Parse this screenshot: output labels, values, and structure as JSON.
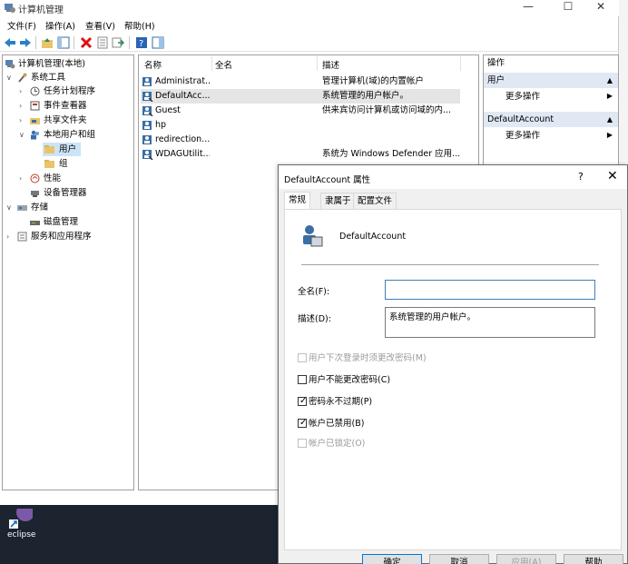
{
  "window": {
    "title": "计算机管理",
    "menus": [
      "文件(F)",
      "操作(A)",
      "查看(V)",
      "帮助(H)"
    ],
    "minimize": "—",
    "maximize": "☐",
    "close": "✕"
  },
  "tree": {
    "root": "计算机管理(本地)",
    "system_tools": "系统工具",
    "task_scheduler": "任务计划程序",
    "event_viewer": "事件查看器",
    "shared_folders": "共享文件夹",
    "local_users_groups": "本地用户和组",
    "users": "用户",
    "groups": "组",
    "performance": "性能",
    "device_manager": "设备管理器",
    "storage": "存储",
    "disk_management": "磁盘管理",
    "services_apps": "服务和应用程序"
  },
  "list": {
    "headers": {
      "name": "名称",
      "fullname": "全名",
      "description": "描述"
    },
    "rows": [
      {
        "name": "Administrat...",
        "fullname": "",
        "description": "管理计算机(域)的内置帐户"
      },
      {
        "name": "DefaultAcc...",
        "fullname": "",
        "description": "系统管理的用户帐户。"
      },
      {
        "name": "Guest",
        "fullname": "",
        "description": "供来宾访问计算机或访问域的内..."
      },
      {
        "name": "hp",
        "fullname": "",
        "description": ""
      },
      {
        "name": "redirection...",
        "fullname": "",
        "description": ""
      },
      {
        "name": "WDAGUtilit...",
        "fullname": "",
        "description": "系统为 Windows Defender 应用..."
      }
    ]
  },
  "actions": {
    "header": "操作",
    "section1": "用户",
    "more1": "更多操作",
    "section2": "DefaultAccount",
    "more2": "更多操作"
  },
  "dialog": {
    "title": "DefaultAccount 属性",
    "help": "?",
    "close": "✕",
    "tabs": [
      "常规",
      "隶属于",
      "配置文件"
    ],
    "account_name": "DefaultAccount",
    "fullname_label": "全名(F):",
    "fullname_value": "",
    "description_label": "描述(D):",
    "description_value": "系统管理的用户帐户。",
    "checkboxes": [
      {
        "label": "用户下次登录时须更改密码(M)",
        "checked": false,
        "disabled": true
      },
      {
        "label": "用户不能更改密码(C)",
        "checked": false,
        "disabled": false
      },
      {
        "label": "密码永不过期(P)",
        "checked": true,
        "disabled": false
      },
      {
        "label": "帐户已禁用(B)",
        "checked": true,
        "disabled": false
      },
      {
        "label": "帐户已锁定(O)",
        "checked": false,
        "disabled": true
      }
    ],
    "buttons": {
      "ok": "确定",
      "cancel": "取消",
      "apply": "应用(A)",
      "help": "帮助"
    }
  },
  "desktop": {
    "icon_label": "eclipse"
  },
  "colors": {
    "selection": "#cce4f7",
    "section": "#dfe8f3",
    "focus": "#0078d7"
  }
}
